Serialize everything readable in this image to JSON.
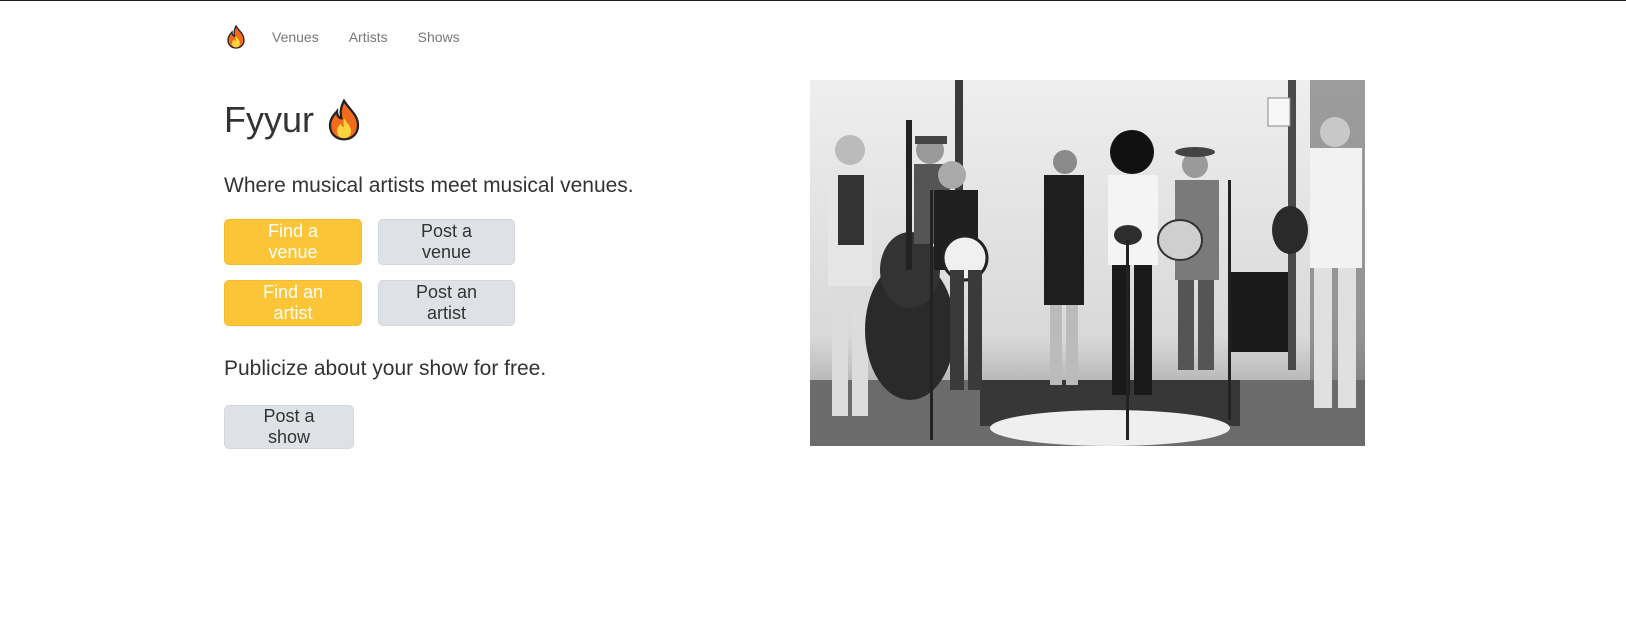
{
  "nav": {
    "brand_icon": "flame-icon",
    "links": [
      "Venues",
      "Artists",
      "Shows"
    ]
  },
  "hero": {
    "title": "Fyyur",
    "title_icon": "flame-icon",
    "lead": "Where musical artists meet musical venues.",
    "find_venue": "Find a venue",
    "post_venue": "Post a venue",
    "find_artist": "Find an artist",
    "post_artist": "Post an artist",
    "show_lead": "Publicize about your show for free.",
    "post_show": "Post a show"
  },
  "colors": {
    "primary": "#fbc537",
    "default": "#dee2e6",
    "nav_link": "#777777",
    "text": "#333333"
  }
}
